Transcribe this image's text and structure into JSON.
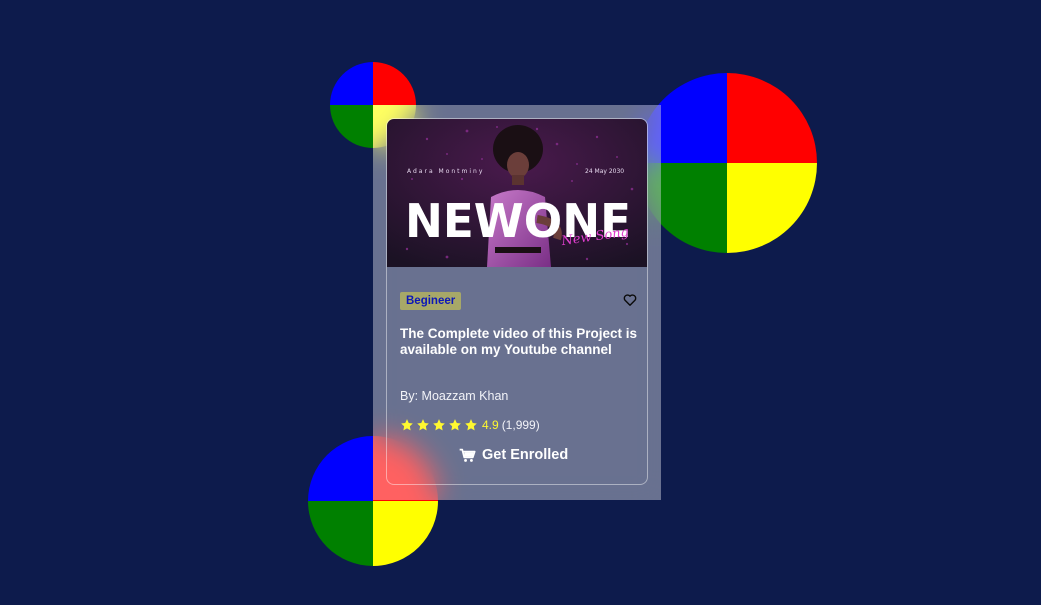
{
  "page": {
    "background_color": "#0d1b4c"
  },
  "decor": {
    "quadrant_colors": [
      "#0000ff",
      "#ff0000",
      "#008000",
      "#ffff00"
    ]
  },
  "card": {
    "thumbnail": {
      "artist_name": "Adara Montminy",
      "date": "24 May 2030",
      "headline": "NEWONE",
      "script_text": "New Song"
    },
    "level_badge": "Begineer",
    "title": "The Complete video of this Project is available on my Youtube channel",
    "author": "By: Moazzam Khan",
    "rating": {
      "stars": 5,
      "value": "4.9",
      "count": "(1,999)"
    },
    "enroll_label": "Get Enrolled",
    "icons": {
      "favorite": "heart-icon",
      "enroll": "cart-icon",
      "rating": "star-icon"
    }
  }
}
